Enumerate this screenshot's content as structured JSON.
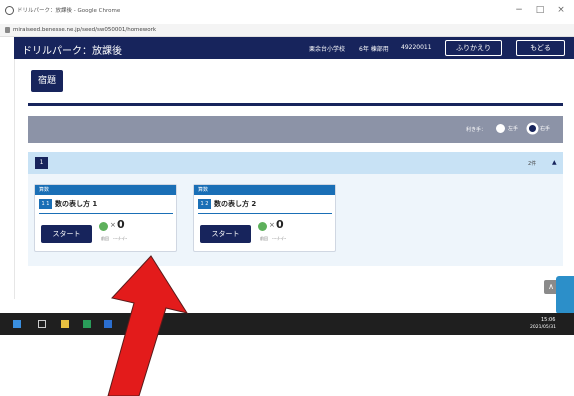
{
  "browser": {
    "window_title": "ドリルパーク：放課後 - Google Chrome",
    "url": "miraiseed.benesse.ne.jp/seed/sw050001/homework",
    "minimize": "−",
    "maximize": "□",
    "close": "×"
  },
  "header": {
    "app_title": "ドリルパーク：放課後",
    "school": "栗余台小学校",
    "class": "6年 棟部用",
    "user_id": "49220011",
    "review_button": "ふりかえり",
    "back_button": "もどる"
  },
  "tab": {
    "label": "宿題"
  },
  "options": {
    "hand_label": "利き手：",
    "left_label": "左手",
    "right_label": "右手",
    "selected": "right"
  },
  "section": {
    "number": "1",
    "count": "2件",
    "chevron": "▲"
  },
  "cards": [
    {
      "tag": "算数",
      "unit": "1 1",
      "title": "数の表し方 1",
      "start": "スタート",
      "times": "×",
      "count": "0",
      "date_label": "前回",
      "date_value": "----/--/--"
    },
    {
      "tag": "算数",
      "unit": "1 2",
      "title": "数の表し方 2",
      "start": "スタート",
      "times": "×",
      "count": "0",
      "date_label": "前回",
      "date_value": "----/--/--"
    }
  ],
  "taskbar": {
    "time": "15:06",
    "date": "2021/05/31"
  },
  "colors": {
    "navy": "#17245c",
    "blue": "#1a6fb6",
    "section_bg": "#c8e2f5",
    "options_bg": "#8c93a7",
    "arrow": "#e31b1b"
  }
}
